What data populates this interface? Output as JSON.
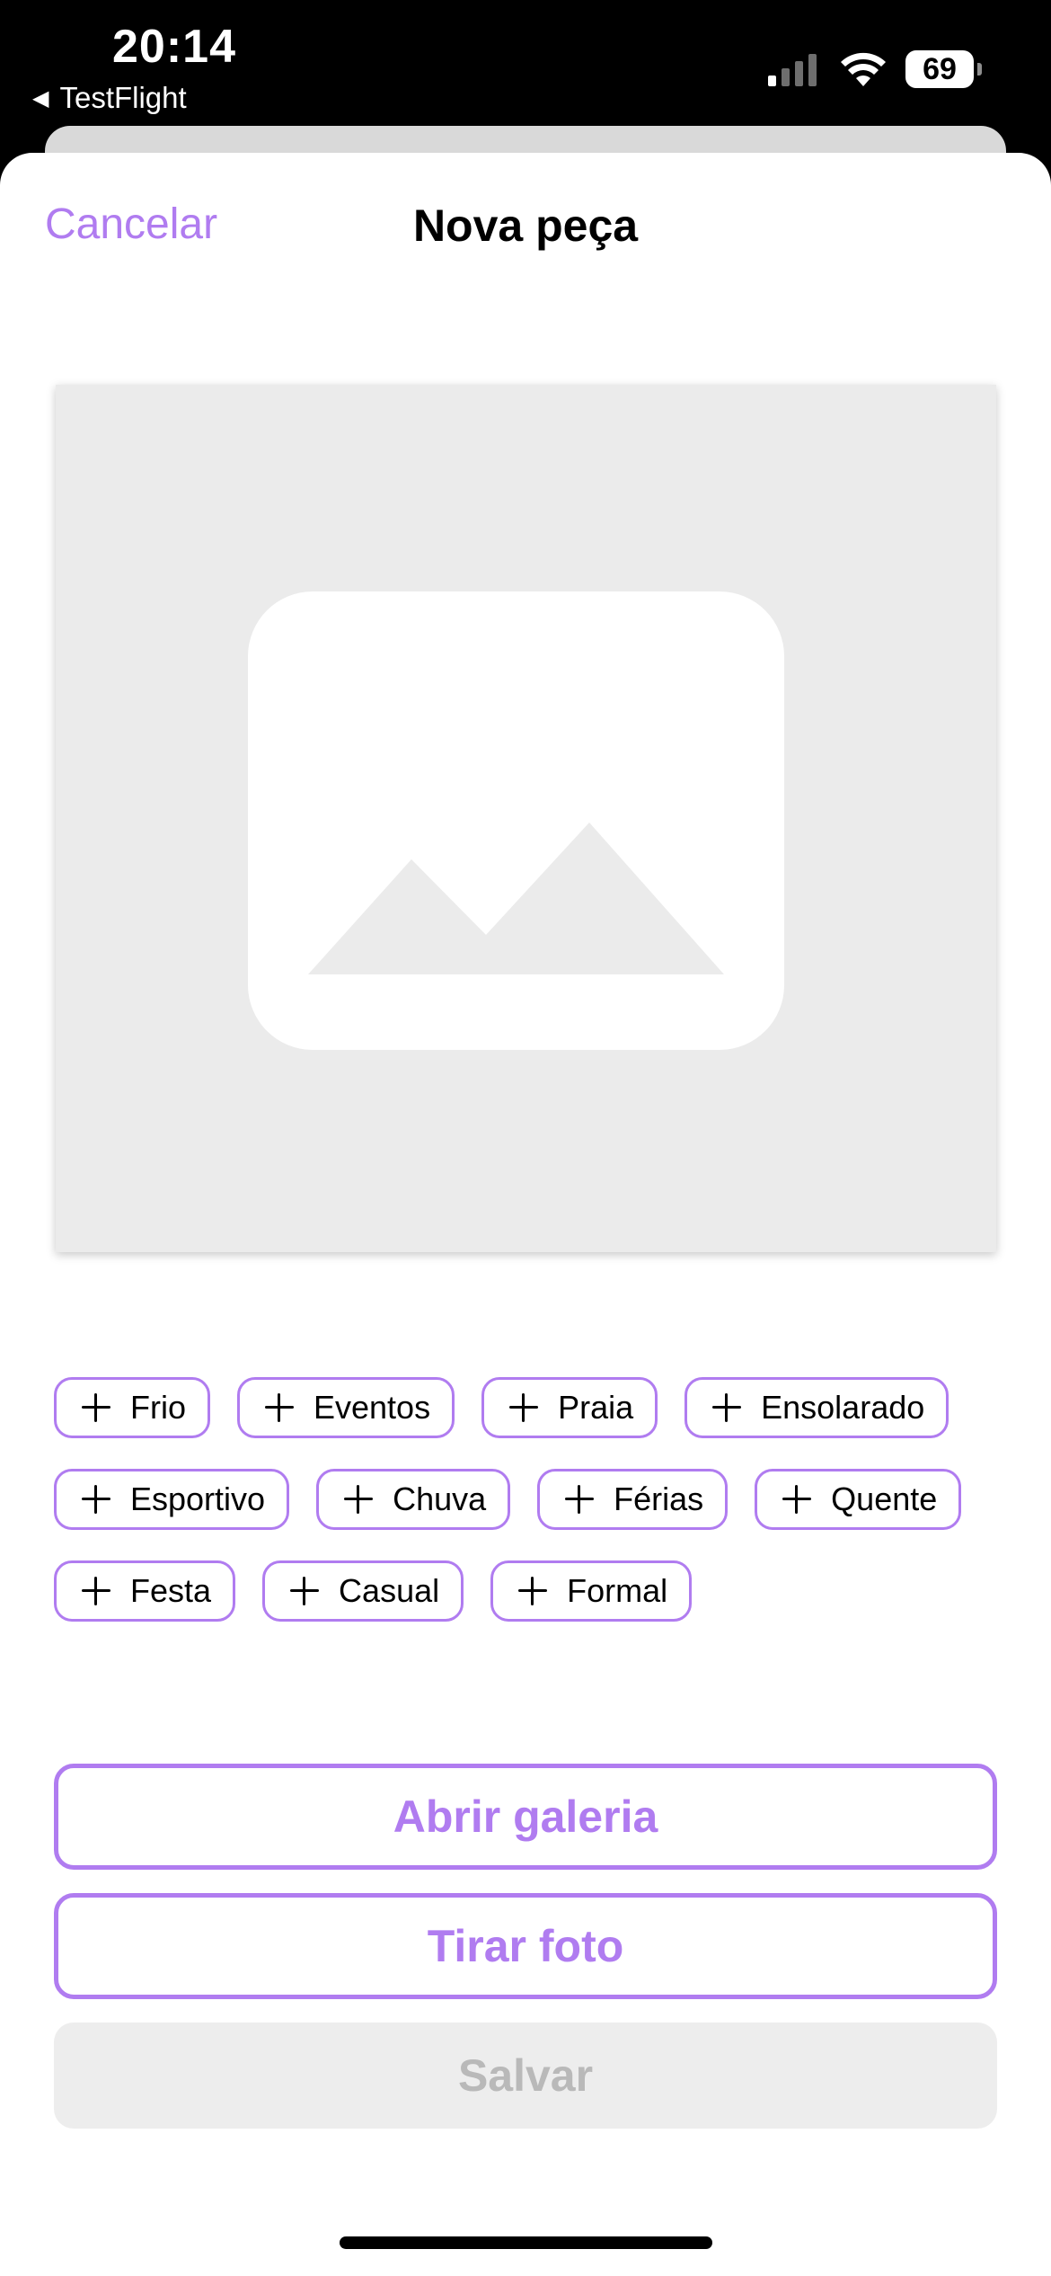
{
  "status_bar": {
    "time": "20:14",
    "back_app": "TestFlight",
    "battery": "69"
  },
  "nav": {
    "cancel_label": "Cancelar",
    "title": "Nova peça"
  },
  "tags": [
    [
      "Frio",
      "Eventos",
      "Praia",
      "Ensolarado"
    ],
    [
      "Esportivo",
      "Chuva",
      "Férias",
      "Quente"
    ],
    [
      "Festa",
      "Casual",
      "Formal"
    ]
  ],
  "actions": {
    "gallery_label": "Abrir galeria",
    "photo_label": "Tirar foto",
    "save_label": "Salvar"
  },
  "colors": {
    "accent": "#b07cf0",
    "placeholder_bg": "#ebebeb",
    "disabled_bg": "#ededed",
    "disabled_text": "#b9b9b9"
  }
}
